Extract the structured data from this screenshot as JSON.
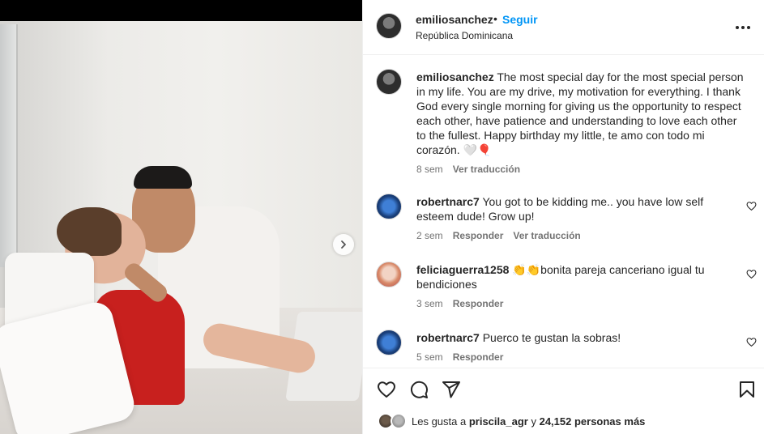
{
  "post": {
    "username": "emiliosanchez",
    "follow_label": "Seguir",
    "dot": "•",
    "location": "República Dominicana"
  },
  "caption": {
    "username": "emiliosanchez",
    "text": "The most special day for the most special person in my life. You are my drive, my motivation for everything. I thank God every single morning for giving us the opportunity to respect each other, have patience and understanding to love each other to the fullest. Happy birthday my little, te amo con todo mi corazón. 🤍🎈",
    "time": "8 sem",
    "translate": "Ver traducción"
  },
  "comments": [
    {
      "username": "robertnarc7",
      "text": "You got to be kidding me.. you have low self esteem dude! Grow up!",
      "time": "2 sem",
      "reply": "Responder",
      "translate": "Ver traducción"
    },
    {
      "username": "feliciaguerra1258",
      "text": "👏👏bonita pareja canceriano igual tu bendiciones",
      "time": "3 sem",
      "reply": "Responder"
    },
    {
      "username": "robertnarc7",
      "text": "Puerco te gustan la sobras!",
      "time": "5 sem",
      "reply": "Responder"
    }
  ],
  "likes": {
    "prefix": "Les gusta a",
    "first_user": "priscila_agr",
    "connector": "y",
    "others": "24,152 personas más"
  },
  "icons": {
    "like": "heart-icon",
    "comment": "comment-icon",
    "share": "send-icon",
    "save": "bookmark-icon",
    "more": "more-options-icon",
    "next": "chevron-right-icon"
  },
  "colors": {
    "follow_blue": "#0095f6",
    "meta_gray": "#737373",
    "text": "#262626"
  }
}
